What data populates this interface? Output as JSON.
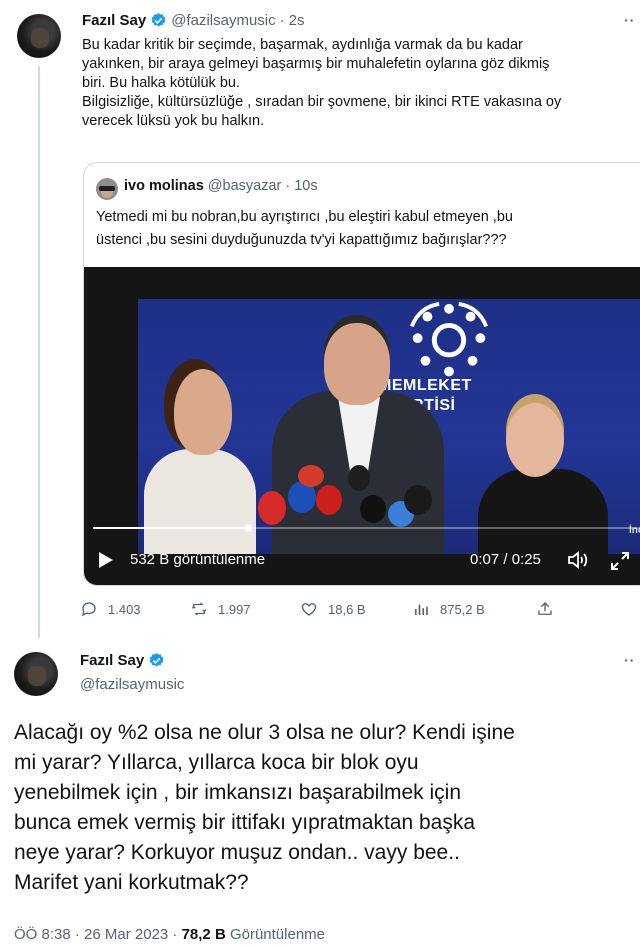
{
  "first_tweet": {
    "name": "Fazıl Say",
    "handle": "@fazilsaymusic",
    "time": "2s",
    "text_lines": [
      "Bu kadar kritik bir seçimde, başarmak, aydınlığa varmak da bu kadar",
      "yakınken, bir araya gelmeyi başarmış bir muhalefetin oylarına göz dikmiş",
      "biri. Bu halka kötülük bu.",
      "Bilgisizliğe, kültürsüzlüğe , sıradan bir şovmene, bir ikinci RTE vakasına oy",
      "verecek lüksü yok bu halkın."
    ],
    "more_icon": "more-icon"
  },
  "quoted_tweet": {
    "name": "ivo molinas",
    "handle": "@basyazar",
    "time": "10s",
    "text_lines": [
      "Yetmedi mi bu nobran,bu ayrıştırıcı ,bu eleştiri kabul etmeyen ,bu",
      "üstenci ,bu sesini duyduğunuzda tv'yi kapattığımız bağırışlar???"
    ],
    "video": {
      "banner_text_line1": "MEMLEKET",
      "banner_text_line2": "PARTİSİ",
      "watermark": "İnce",
      "views_label": "532 B görüntülenme",
      "time_label": "0:07 / 0:25",
      "progress": 0.28,
      "icons": [
        "play-icon",
        "volume-icon",
        "fullscreen-icon"
      ]
    }
  },
  "actions": {
    "replies": "1.403",
    "retweets": "1.997",
    "likes": "18,6 B",
    "views": "875,2 B"
  },
  "main_tweet": {
    "name": "Fazıl Say",
    "handle": "@fazilsaymusic",
    "text_lines": [
      "Alacağı oy %2 olsa ne olur 3 olsa ne olur? Kendi işine",
      "mi yarar?  Yıllarca, yıllarca koca bir blok oyu",
      "yenebilmek için , bir imkansızı başarabilmek için",
      "bunca emek vermiş bir ittifakı yıpratmaktan başka",
      "neye yarar? Korkuyor muşuz ondan.. vayy bee..",
      "Marifet yani korkutmak??"
    ],
    "footer_time": "ÖÖ 8:38 · 26 Mar 2023 · ",
    "footer_views": "78,2 B",
    "footer_views_label": " Görüntülenme"
  },
  "colors": {
    "verified": "#1d9bf0",
    "muted": "#536471",
    "border": "#cfd9de"
  }
}
